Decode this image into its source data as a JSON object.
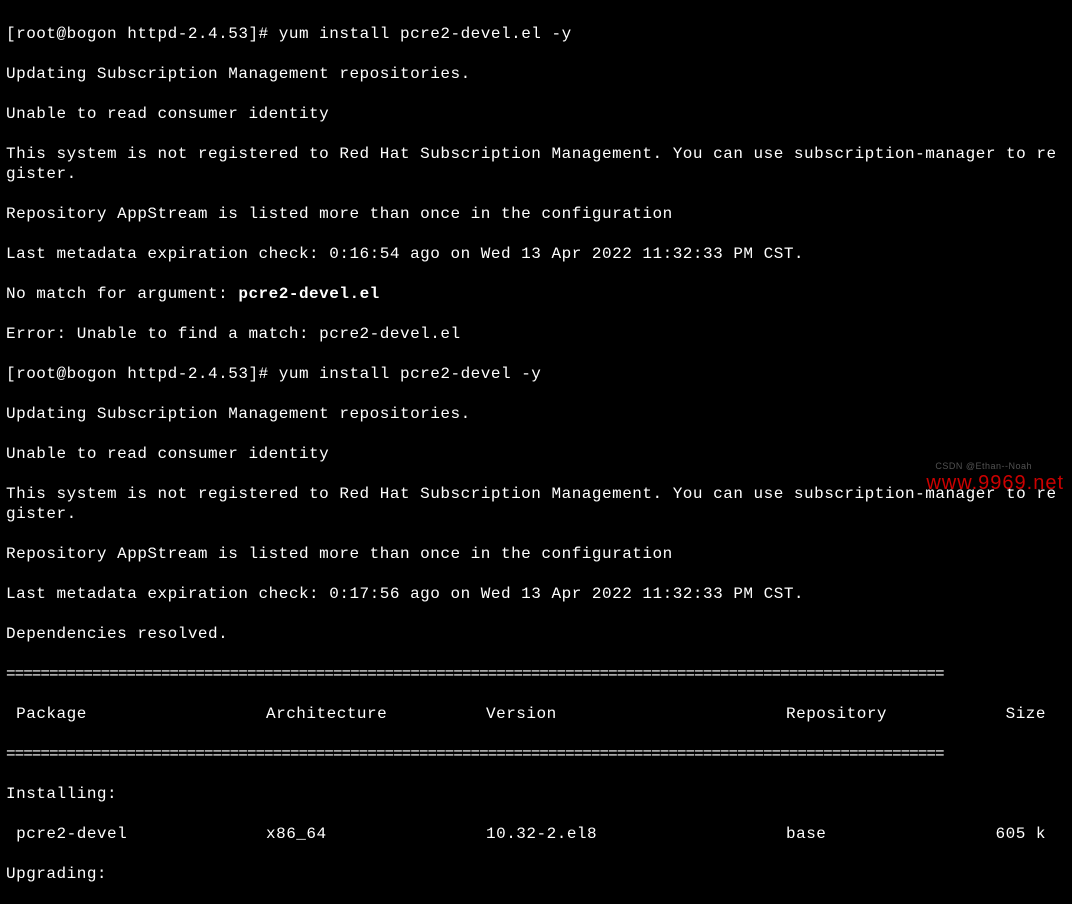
{
  "prompt1": "[root@bogon httpd-2.4.53]# ",
  "cmd1": "yum install pcre2-devel.el -y",
  "out1_line1": "Updating Subscription Management repositories.",
  "out1_line2": "Unable to read consumer identity",
  "out1_line3": "This system is not registered to Red Hat Subscription Management. You can use subscription-manager to register.",
  "out1_line4": "Repository AppStream is listed more than once in the configuration",
  "out1_line5": "Last metadata expiration check: 0:16:54 ago on Wed 13 Apr 2022 11:32:33 PM CST.",
  "out1_line6a": "No match for argument: ",
  "out1_line6b": "pcre2-devel.el",
  "out1_line7": "Error: Unable to find a match: pcre2-devel.el",
  "prompt2": "[root@bogon httpd-2.4.53]# ",
  "cmd2": "yum install pcre2-devel -y",
  "out2_line1": "Updating Subscription Management repositories.",
  "out2_line2": "Unable to read consumer identity",
  "out2_line3": "This system is not registered to Red Hat Subscription Management. You can use subscription-manager to register.",
  "out2_line4": "Repository AppStream is listed more than once in the configuration",
  "out2_line5": "Last metadata expiration check: 0:17:56 ago on Wed 13 Apr 2022 11:32:33 PM CST.",
  "out2_line6": "Dependencies resolved.",
  "divider": "=============================================================================================================",
  "header": {
    "package": " Package",
    "arch": "Architecture",
    "version": "Version",
    "repo": "Repository",
    "size": "Size"
  },
  "installing_label": "Installing:",
  "pkg": {
    "name": " pcre2-devel",
    "arch": "x86_64",
    "version": "10.32-2.el8",
    "repo": "base",
    "size": "605 k"
  },
  "upgrading_label": "Upgrading:",
  "watermark": "www.9969.net",
  "watermark_small": "CSDN @Ethan--Noah"
}
